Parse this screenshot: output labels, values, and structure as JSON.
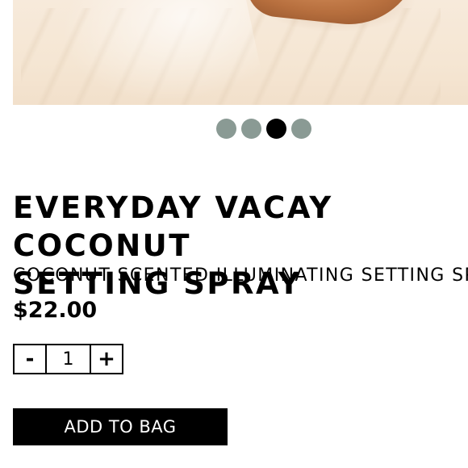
{
  "gallery": {
    "image_name": "product-photo-crop",
    "dots": [
      {
        "active": false
      },
      {
        "active": false
      },
      {
        "active": true
      },
      {
        "active": false
      }
    ],
    "dot_color": "#8a9a94",
    "dot_active_color": "#000000"
  },
  "product": {
    "title": "EVERYDAY VACAY COCONUT\nSETTING SPRAY",
    "subtitle": "COCONUT SCENTED ILLUMINATING SETTING SPRAY",
    "price": "$22.00"
  },
  "quantity": {
    "minus_label": "-",
    "value": "1",
    "plus_label": "+"
  },
  "actions": {
    "add_to_bag_label": "ADD TO BAG"
  }
}
